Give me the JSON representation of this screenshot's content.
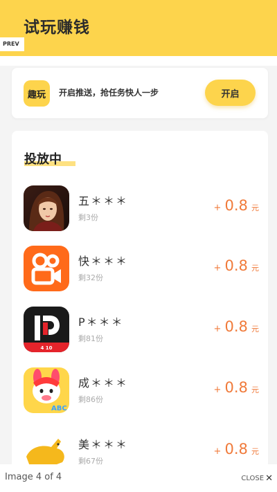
{
  "header": {
    "title": "试玩赚钱"
  },
  "lightbox": {
    "prev_label": "PREV",
    "counter": "Image 4 of 4",
    "close_label": "CLOSE",
    "close_glyph": "✕"
  },
  "push": {
    "logo_text": "趣玩",
    "text": "开启推送，抢任务快人一步",
    "button_label": "开启"
  },
  "section": {
    "title": "投放中"
  },
  "apps": [
    {
      "name": "五＊＊＊",
      "remaining": "剩3份",
      "plus": "+",
      "amount": "0.8",
      "unit": "元",
      "icon": "game-character-icon"
    },
    {
      "name": "快＊＊＊",
      "remaining": "剩32份",
      "plus": "+",
      "amount": "0.8",
      "unit": "元",
      "icon": "kuaishou-icon"
    },
    {
      "name": "P＊＊＊",
      "remaining": "剩81份",
      "plus": "+",
      "amount": "0.8",
      "unit": "元",
      "icon": "p-logo-icon"
    },
    {
      "name": "成＊＊＊",
      "remaining": "剩86份",
      "plus": "+",
      "amount": "0.8",
      "unit": "元",
      "icon": "bunny-abc-icon"
    },
    {
      "name": "美＊＊＊",
      "remaining": "剩67份",
      "plus": "+",
      "amount": "0.8",
      "unit": "元",
      "icon": "kangaroo-icon"
    }
  ],
  "colors": {
    "brand_yellow": "#fdd44c",
    "reward_orange": "#f07a3a"
  }
}
